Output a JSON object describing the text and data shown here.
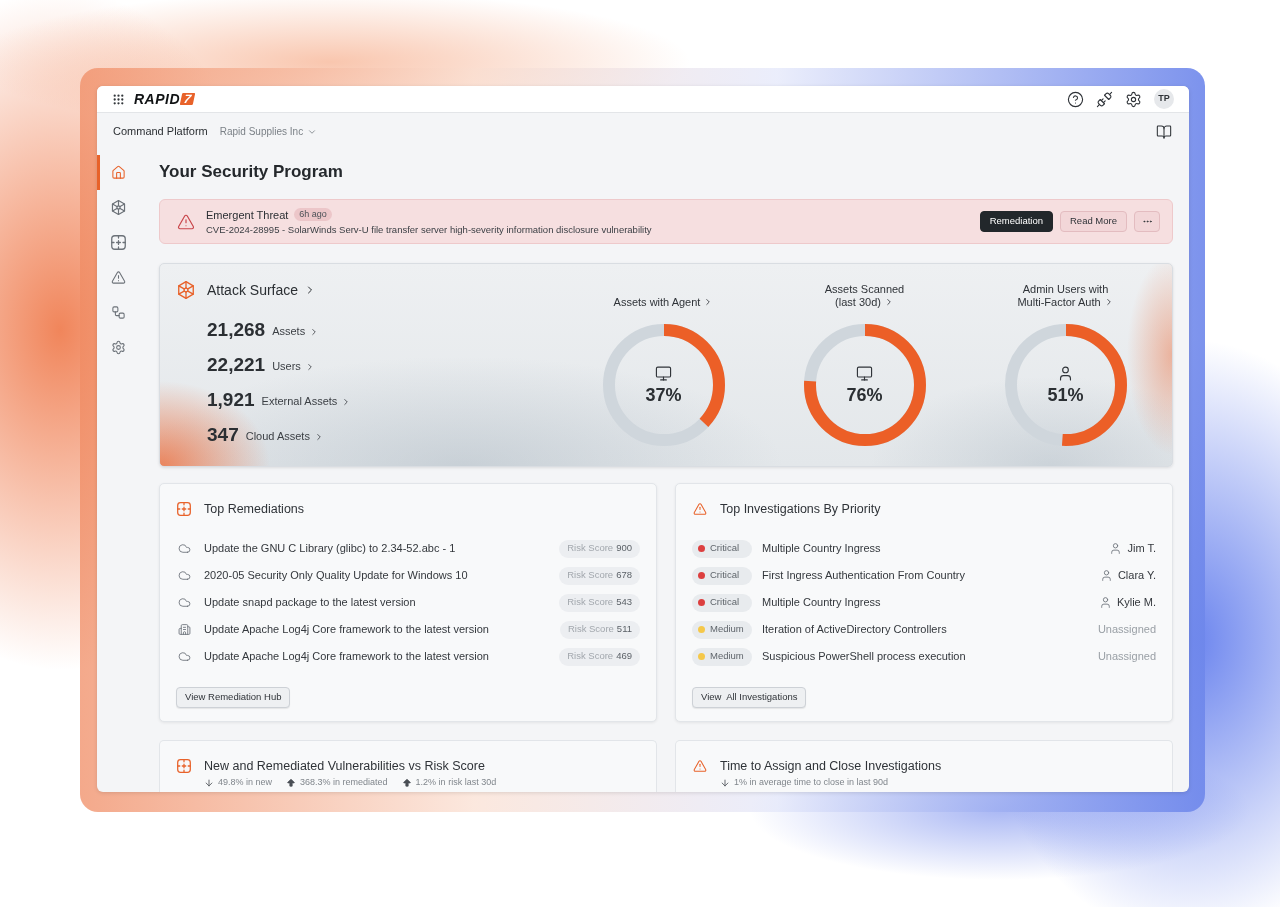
{
  "topbar": {
    "logo": {
      "wordmark": "RAPID",
      "mark": "7"
    },
    "avatar": "TP"
  },
  "header": {
    "platform": "Command Platform",
    "organization": "Rapid Supplies Inc"
  },
  "sidebar": {
    "items": [
      {
        "kind": "home",
        "selected": true
      },
      {
        "kind": "attack-surface",
        "selected": false
      },
      {
        "kind": "remediation",
        "selected": false
      },
      {
        "kind": "investigations",
        "selected": false
      },
      {
        "kind": "automation",
        "selected": false
      },
      {
        "kind": "settings",
        "selected": false
      }
    ]
  },
  "page_title": "Your Security Program",
  "alert": {
    "title": "Emergent Threat",
    "age": "6h ago",
    "description": "CVE-2024-28995 - SolarWinds Serv-U file transfer server high-severity information disclosure vulnerability",
    "buttons": [
      {
        "label": "Remediation",
        "primary": true
      },
      {
        "label": "Read More",
        "primary": false
      }
    ]
  },
  "attack_surface": {
    "title": "Attack Surface",
    "stats": [
      {
        "value": "21,268",
        "label": "Assets"
      },
      {
        "value": "22,221",
        "label": "Users"
      },
      {
        "value": "1,921",
        "label": "External Assets"
      },
      {
        "value": "347",
        "label": "Cloud Assets"
      }
    ],
    "gauges": [
      {
        "label": "Assets with Agent",
        "kind": "device",
        "value": "37%",
        "level": 0.37
      },
      {
        "label": "Assets Scanned (last 30d)",
        "kind": "device",
        "value": "76%",
        "level": 0.76
      },
      {
        "label": "Admin Users with Multi-Factor Auth",
        "kind": "user",
        "value": "51%",
        "level": 0.51
      }
    ]
  },
  "remediations": {
    "title": "Top Remediations",
    "rows": [
      {
        "kind": "cloud",
        "title": "Update the GNU C Library (glibc) to 2.34-52.abc - 1",
        "score_label": "Risk Score",
        "score": "900"
      },
      {
        "kind": "cloud",
        "title": "2020-05 Security Only Quality Update for Windows 10",
        "score_label": "Risk Score",
        "score": "678"
      },
      {
        "kind": "cloud",
        "title": "Update snapd package to the latest version",
        "score_label": "Risk Score",
        "score": "543"
      },
      {
        "kind": "building",
        "title": "Update Apache Log4j Core framework to the latest version",
        "score_label": "Risk Score",
        "score": "511"
      },
      {
        "kind": "cloud",
        "title": "Update Apache Log4j Core framework to the latest version",
        "score_label": "Risk Score",
        "score": "469"
      }
    ],
    "button": "View Remediation Hub"
  },
  "investigations": {
    "title": "Top Investigations By Priority",
    "rows": [
      {
        "priority": "Critical",
        "color": "#dc3f3f",
        "title": "Multiple Country Ingress",
        "assignee": "Jim T.",
        "assigned": true
      },
      {
        "priority": "Critical",
        "color": "#dc3f3f",
        "title": "First Ingress Authentication From Country",
        "assignee": "Clara Y.",
        "assigned": true
      },
      {
        "priority": "Critical",
        "color": "#dc3f3f",
        "title": "Multiple Country Ingress",
        "assignee": "Kylie M.",
        "assigned": true
      },
      {
        "priority": "Medium",
        "color": "#f5c84a",
        "title": "Iteration of ActiveDirectory Controllers",
        "assignee": "Unassigned",
        "assigned": false
      },
      {
        "priority": "Medium",
        "color": "#f5c84a",
        "title": "Suspicious PowerShell process execution",
        "assignee": "Unassigned",
        "assigned": false
      }
    ],
    "button": "View  All Investigations"
  },
  "trend_cards": [
    {
      "kind": "remediation",
      "title": "New and Remediated Vulnerabilities vs Risk Score",
      "trends": [
        {
          "kind": "down",
          "text": "49.8% in new"
        },
        {
          "kind": "up",
          "text": "368.3% in remediated"
        },
        {
          "kind": "up",
          "text": "1.2% in risk last 30d"
        }
      ]
    },
    {
      "kind": "investigations",
      "title": "Time to Assign and Close Investigations",
      "trends": [
        {
          "kind": "down",
          "text": "1% in average time to close in last 90d"
        }
      ]
    }
  ]
}
